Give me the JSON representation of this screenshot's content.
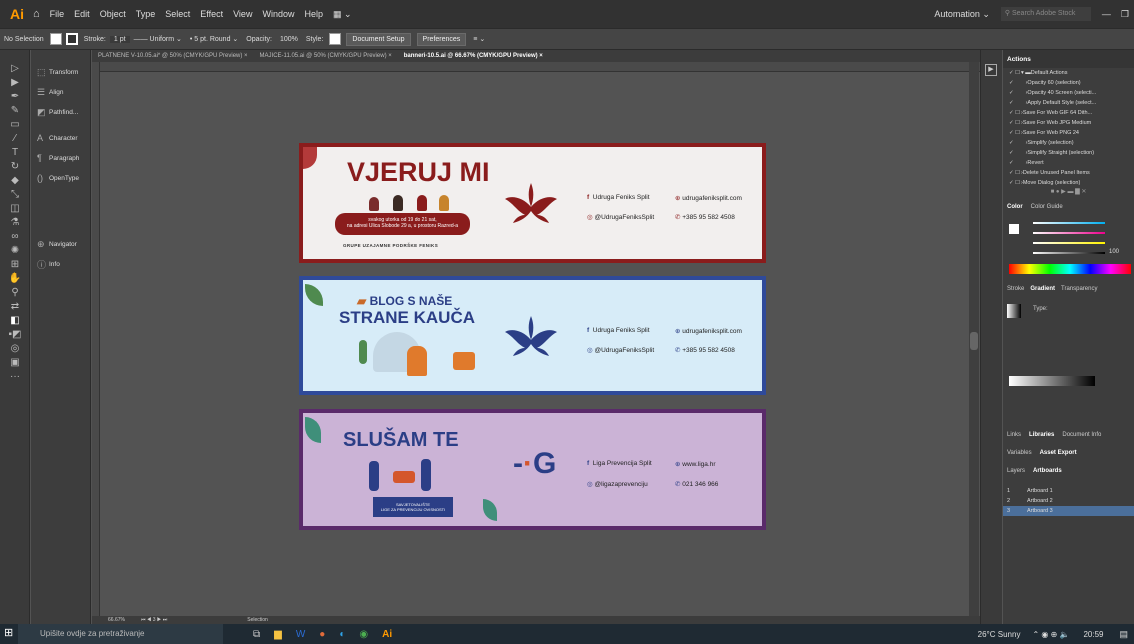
{
  "menubar": {
    "logo": "Ai",
    "items": [
      "File",
      "Edit",
      "Object",
      "Type",
      "Select",
      "Effect",
      "View",
      "Window",
      "Help"
    ],
    "workspace": "Automation",
    "search_placeholder": "Search Adobe Stock"
  },
  "controlbar": {
    "selection": "No Selection",
    "stroke_label": "Stroke:",
    "stroke_value": "1 pt",
    "uniform": "Uniform",
    "brush": "5 pt. Round",
    "opacity_label": "Opacity:",
    "opacity_value": "100%",
    "style_label": "Style:",
    "doc_setup": "Document Setup",
    "preferences": "Preferences"
  },
  "tabs": [
    "PLATNENE V-10.05.ai* @ 50% (CMYK/GPU Preview)",
    "MAJICE-11.05.ai @ 50% (CMYK/GPU Preview)",
    "banneri-10.5.ai @ 66.67% (CMYK/GPU Preview)"
  ],
  "leftpanel": {
    "items": [
      "Transform",
      "Align",
      "Pathfind...",
      "Character",
      "Paragraph",
      "OpenType",
      "Navigator",
      "Info"
    ]
  },
  "banners": {
    "b1": {
      "title": "VJERUJ MI",
      "line1": "svakog utorka od 19 do 21 sat,",
      "line2": "na adresi Ulica Slobode 29 a, u prostoru Razred-a",
      "footer": "GRUPE UZAJAMNE PODRŠKE FENIKS",
      "fb": "Udruga Feniks Split",
      "ig": "@UdrugaFeniksSplit",
      "web": "udrugafeniksplit.com",
      "phone": "+385 95 582 4508"
    },
    "b2": {
      "title1": "BLOG S NAŠE",
      "title2": "STRANE KAUČA",
      "fb": "Udruga Feniks Split",
      "ig": "@UdrugaFeniksSplit",
      "web": "udrugafeniksplit.com",
      "phone": "+385 95 582 4508"
    },
    "b3": {
      "title": "SLUŠAM TE",
      "footer1": "SAVJETOVALIŠTE",
      "footer2": "LIGE ZA PREVENCIJU OVISNOSTI",
      "fb": "Liga Prevencija Split",
      "ig": "@ligazaprevenciju",
      "web": "www.liga.hr",
      "phone": "021 346 966"
    }
  },
  "actions": {
    "title": "Actions",
    "items": [
      "Default Actions",
      "Opacity 60 (selection)",
      "Opacity 40 Screen (selecti...",
      "Apply Default Style (select...",
      "Save For Web GIF 64 Dith...",
      "Save For Web JPG Medium",
      "Save For Web PNG 24",
      "Simplify (selection)",
      "Simplify Straight (selection)",
      "Revert",
      "Delete Unused Panel Items",
      "Move Dialog (selection)"
    ]
  },
  "color": {
    "tab1": "Color",
    "tab2": "Color Guide",
    "k_value": "100"
  },
  "gradient": {
    "tab1": "Stroke",
    "tab2": "Gradient",
    "tab3": "Transparency",
    "type_label": "Type:"
  },
  "links": {
    "tab1": "Links",
    "tab2": "Libraries",
    "tab3": "Document Info",
    "tab4": "Variables",
    "tab5": "Asset Export"
  },
  "layers": {
    "tab1": "Layers",
    "tab2": "Artboards",
    "rows": [
      {
        "num": "1",
        "name": "Artboard 1"
      },
      {
        "num": "2",
        "name": "Artboard 2"
      },
      {
        "num": "3",
        "name": "Artboard 3"
      }
    ]
  },
  "status": {
    "zoom": "66.67%",
    "artboard": "3",
    "tool": "Selection"
  },
  "taskbar": {
    "search": "Upišite ovdje za pretraživanje",
    "weather": "26°C Sunny",
    "time": "20:59"
  }
}
